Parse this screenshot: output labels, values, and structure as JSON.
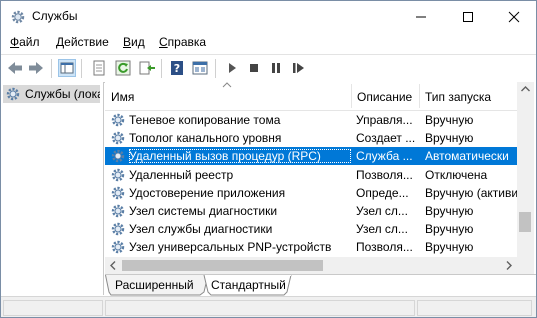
{
  "window": {
    "title": "Службы"
  },
  "menu": [
    {
      "mnemonic": "Ф",
      "rest": "айл"
    },
    {
      "mnemonic": "Д",
      "rest": "ействие"
    },
    {
      "mnemonic": "В",
      "rest": "ид"
    },
    {
      "mnemonic": "С",
      "rest": "правка"
    }
  ],
  "tree": {
    "item_label": "Службы (локальные)"
  },
  "columns": {
    "name": "Имя",
    "description": "Описание",
    "startup": "Тип запуска"
  },
  "services": [
    {
      "name": "Теневое копирование тома",
      "description": "Управля...",
      "startup": "Вручную"
    },
    {
      "name": "Тополог канального уровня",
      "description": "Создает ...",
      "startup": "Вручную"
    },
    {
      "name": "Удаленный вызов процедур (RPC)",
      "description": "Служба ...",
      "startup": "Автоматически"
    },
    {
      "name": "Удаленный реестр",
      "description": "Позволя...",
      "startup": "Отключена"
    },
    {
      "name": "Удостоверение приложения",
      "description": "Опреде...",
      "startup": "Вручную (активи"
    },
    {
      "name": "Узел системы диагностики",
      "description": "Узел сл...",
      "startup": "Вручную"
    },
    {
      "name": "Узел службы диагностики",
      "description": "Узел сл...",
      "startup": "Вручную"
    },
    {
      "name": "Узел универсальных PNP-устройств",
      "description": "Позволя...",
      "startup": "Вручную"
    }
  ],
  "selected_row": 2,
  "tabs": {
    "extended": "Расширенный",
    "standard": "Стандартный"
  },
  "colors": {
    "selection": "#0078d7",
    "gear": "#5b7fa6"
  },
  "icons": [
    "back-arrow-icon",
    "forward-arrow-icon",
    "show-tree-icon",
    "properties-icon",
    "refresh-icon",
    "export-icon",
    "help-icon",
    "console-icon",
    "start-service-icon",
    "stop-service-icon",
    "pause-service-icon",
    "restart-service-icon"
  ]
}
